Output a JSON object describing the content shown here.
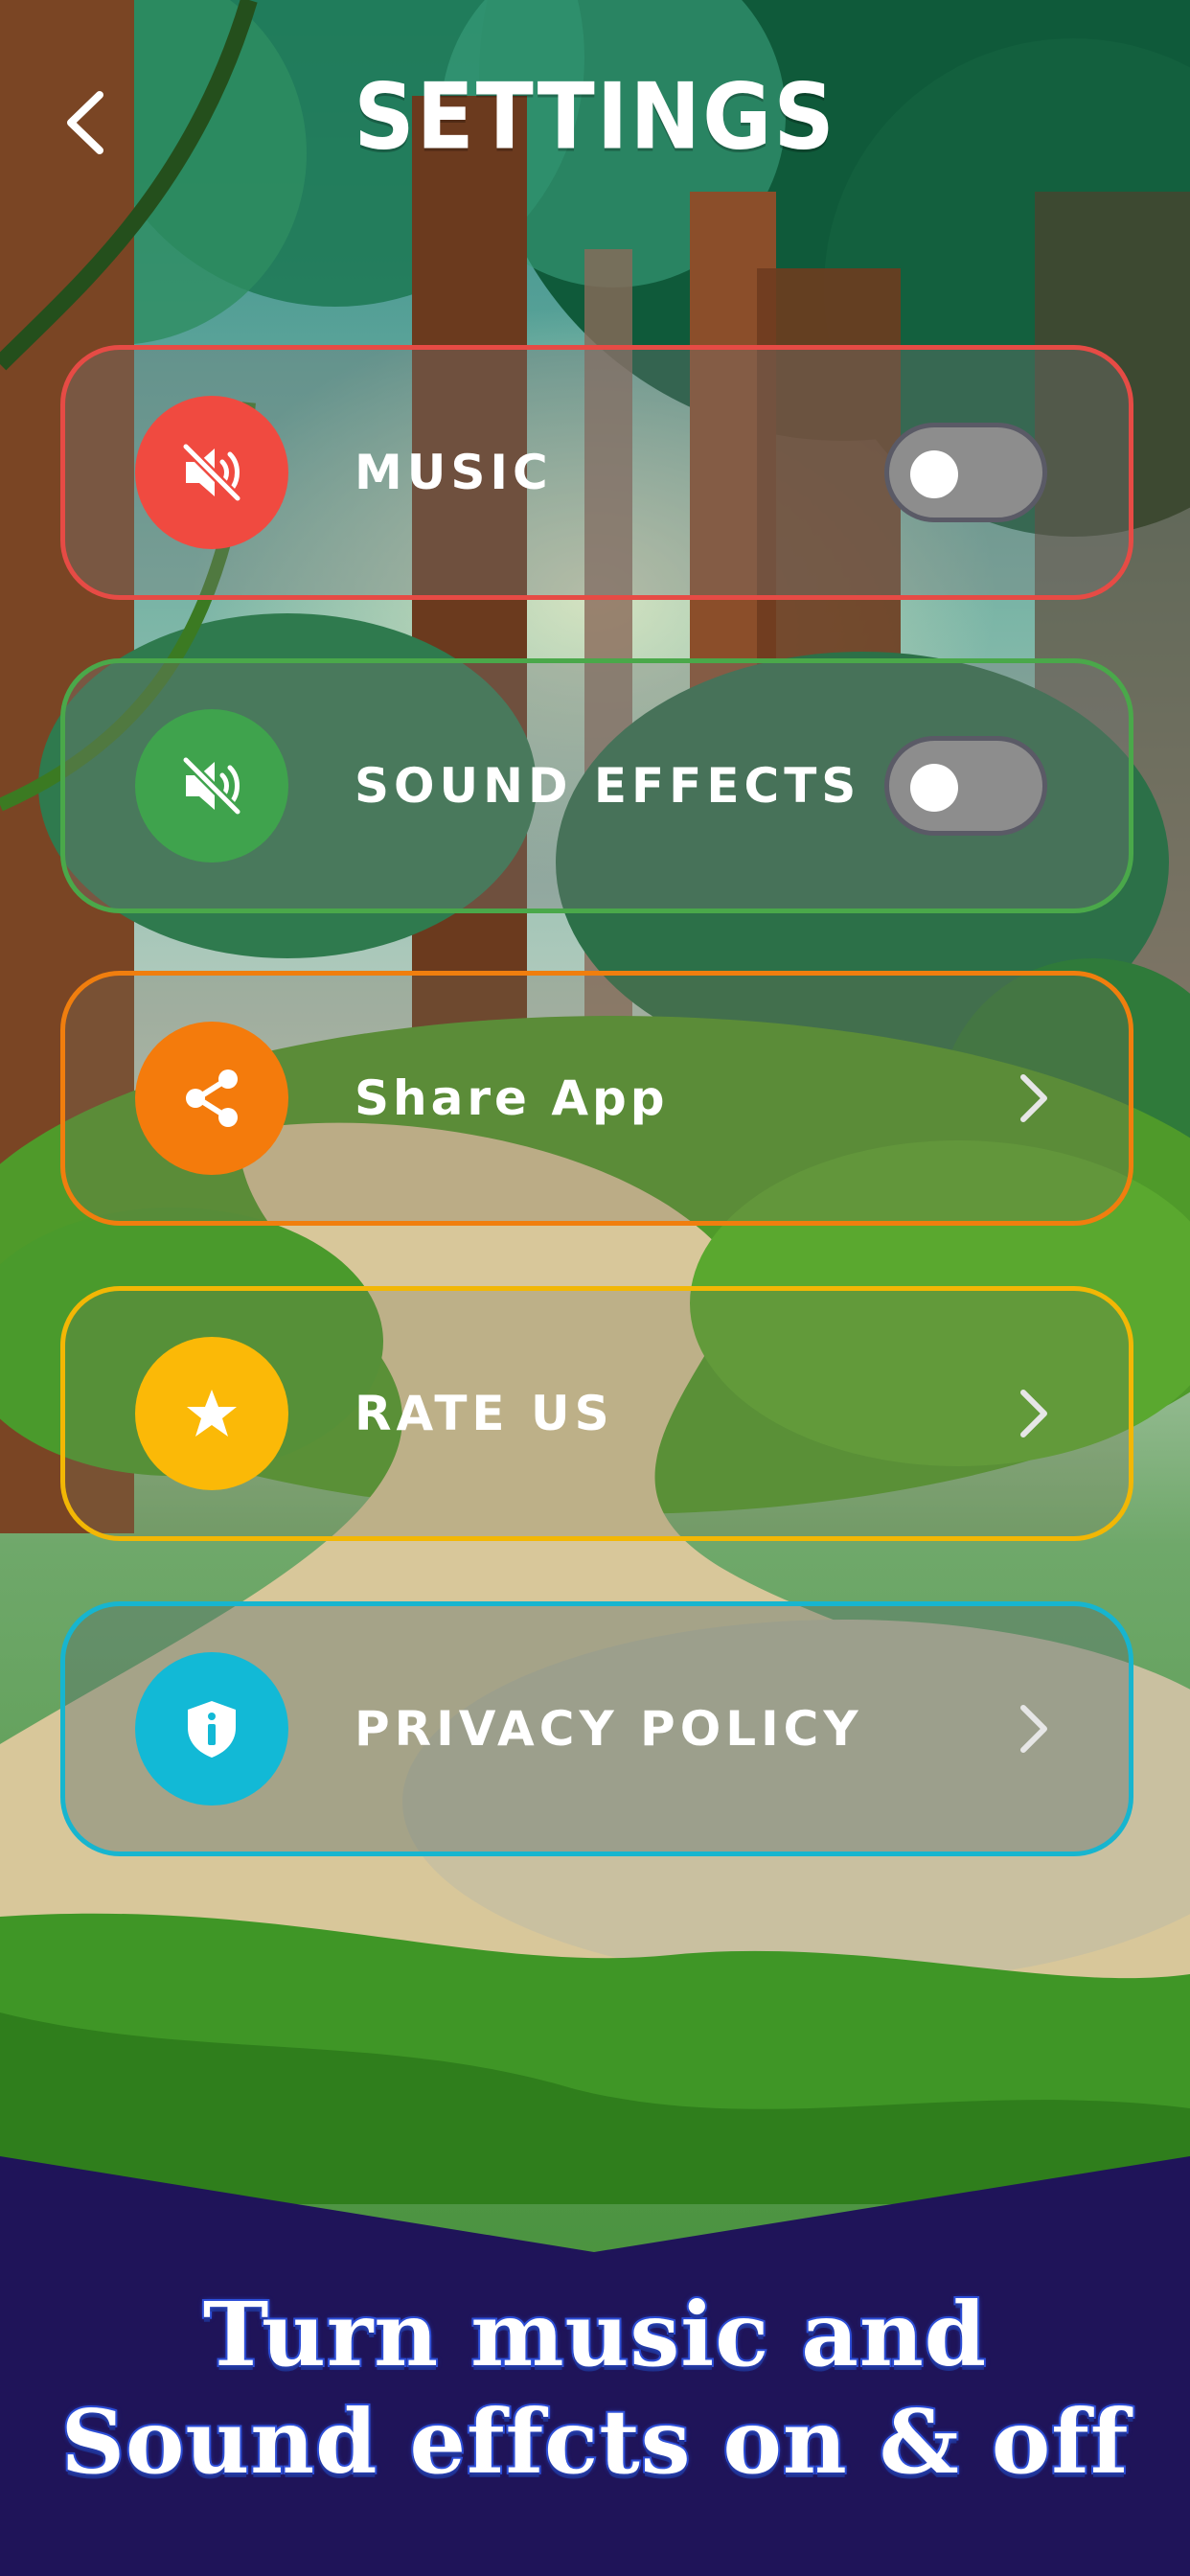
{
  "header": {
    "title": "SETTINGS",
    "back_icon": "chevron-left-icon"
  },
  "settings": [
    {
      "id": "music",
      "label": "MUSIC",
      "icon": "speaker-muted-icon",
      "icon_color": "#f04a40",
      "border_color": "#e64b45",
      "control": "toggle",
      "enabled": false
    },
    {
      "id": "sound_effects",
      "label": "SOUND EFFECTS",
      "icon": "speaker-muted-icon",
      "icon_color": "#3fa34d",
      "border_color": "#4aa84a",
      "control": "toggle",
      "enabled": false
    },
    {
      "id": "share_app",
      "label": "Share App",
      "icon": "share-icon",
      "icon_color": "#f47b0c",
      "border_color": "#f07e0e",
      "control": "chevron"
    },
    {
      "id": "rate_us",
      "label": "RATE US",
      "icon": "star-icon",
      "icon_color": "#fbb907",
      "border_color": "#f2b705",
      "control": "chevron"
    },
    {
      "id": "privacy_policy",
      "label": "PRIVACY POLICY",
      "icon": "shield-info-icon",
      "icon_color": "#12b9d6",
      "border_color": "#17b5cf",
      "control": "chevron"
    }
  ],
  "banner": {
    "line1": "Turn music and",
    "line2": "Sound effcts on & off",
    "background_color": "#1f1459"
  }
}
